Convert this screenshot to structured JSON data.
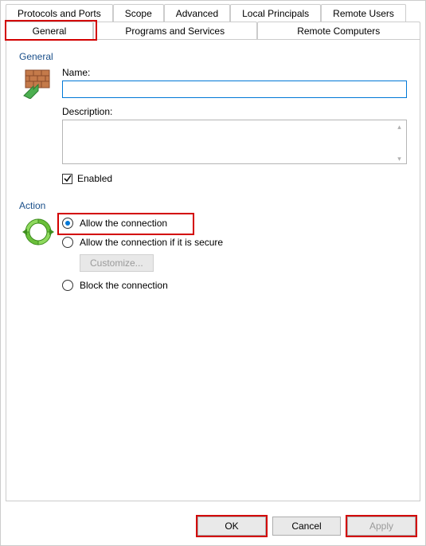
{
  "tabs": {
    "row1": [
      "Protocols and Ports",
      "Scope",
      "Advanced",
      "Local Principals",
      "Remote Users"
    ],
    "row2": [
      "General",
      "Programs and Services",
      "Remote Computers"
    ],
    "active": "General"
  },
  "general": {
    "group_label": "General",
    "name_label": "Name:",
    "name_value": "",
    "description_label": "Description:",
    "description_value": "",
    "enabled_label": "Enabled",
    "enabled_checked": true
  },
  "action": {
    "group_label": "Action",
    "options": {
      "allow": "Allow the connection",
      "allow_secure": "Allow the connection if it is secure",
      "block": "Block the connection"
    },
    "selected": "allow",
    "customize_label": "Customize..."
  },
  "buttons": {
    "ok": "OK",
    "cancel": "Cancel",
    "apply": "Apply"
  }
}
